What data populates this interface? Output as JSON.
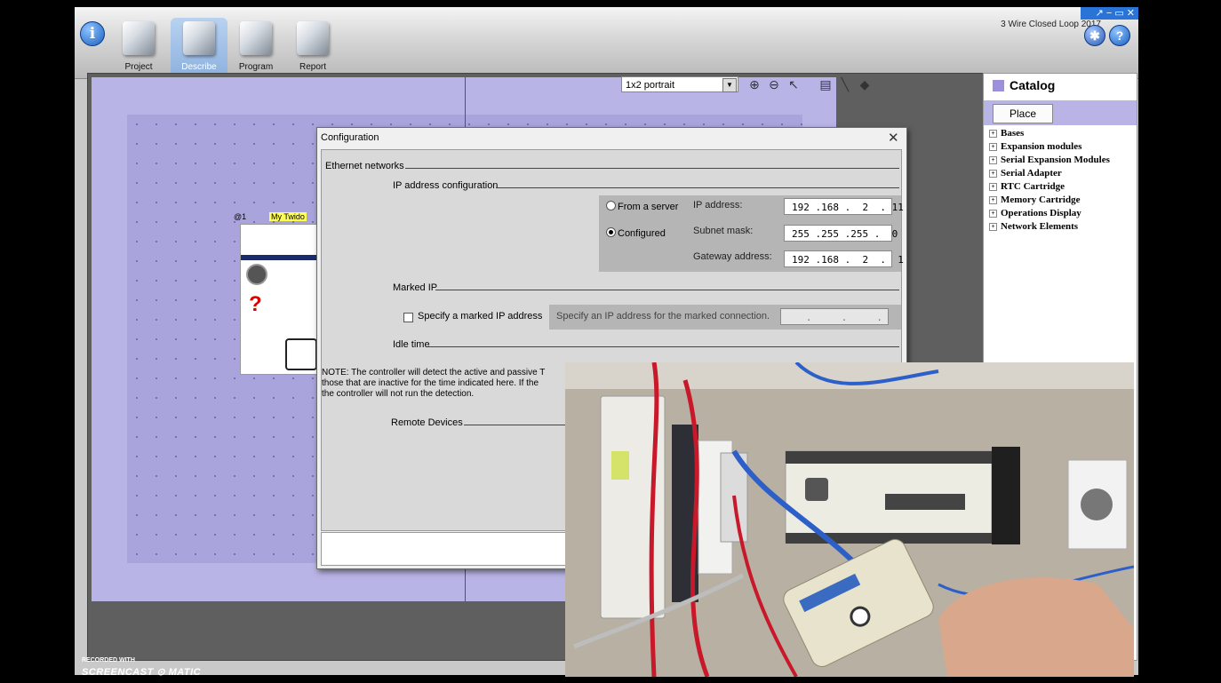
{
  "app": {
    "title": "3 Wire Closed Loop 2017",
    "window_controls": "↗ − ▭ ✕",
    "info_icon": "info-icon",
    "toolbar": [
      {
        "label": "Project",
        "icon": "project-icon"
      },
      {
        "label": "Describe",
        "icon": "describe-icon",
        "active": true
      },
      {
        "label": "Program",
        "icon": "program-icon"
      },
      {
        "label": "Report",
        "icon": "report-icon"
      }
    ]
  },
  "canvas": {
    "page_format": "1x2 portrait",
    "tools": [
      "zoom-in-icon",
      "zoom-out-icon",
      "select-arrow-icon",
      "module-icon",
      "line-tool-icon",
      "eraser-icon"
    ],
    "controller": {
      "index": "@1",
      "name": "My Twido"
    }
  },
  "catalog": {
    "title": "Catalog",
    "place_label": "Place",
    "items": [
      "Bases",
      "Expansion modules",
      "Serial Expansion Modules",
      "Serial Adapter",
      "RTC Cartridge",
      "Memory Cartridge",
      "Operations Display",
      "Network Elements"
    ]
  },
  "dialog": {
    "title": "Configuration",
    "close_glyph": "✕",
    "section_ethernet": "Ethernet networks",
    "section_ip": "IP address configuration",
    "radio_server": "From a server",
    "radio_configured": "Configured",
    "configured_selected": true,
    "ip_label": "IP address:",
    "ip_value": "192 .168 .  2  . 11",
    "subnet_label": "Subnet mask:",
    "subnet_value": "255 .255 .255 .  0",
    "gateway_label": "Gateway address:",
    "gateway_value": "192 .168 .  2  .  1",
    "section_marked": "Marked IP",
    "marked_checkbox": "Specify a marked IP address",
    "marked_hint": "Specify an IP address for the marked connection.",
    "marked_value": "   .     .     .",
    "section_idle": "Idle time",
    "note_lines": [
      "NOTE: The controller will detect the active and passive T",
      "those that are inactive for the time indicated here.  If the",
      "the controller will not run the detection."
    ],
    "section_remote": "Remote Devices"
  },
  "recorder": {
    "line1": "RECORDED WITH",
    "line2": "SCREENCAST ⊙ MATIC"
  }
}
